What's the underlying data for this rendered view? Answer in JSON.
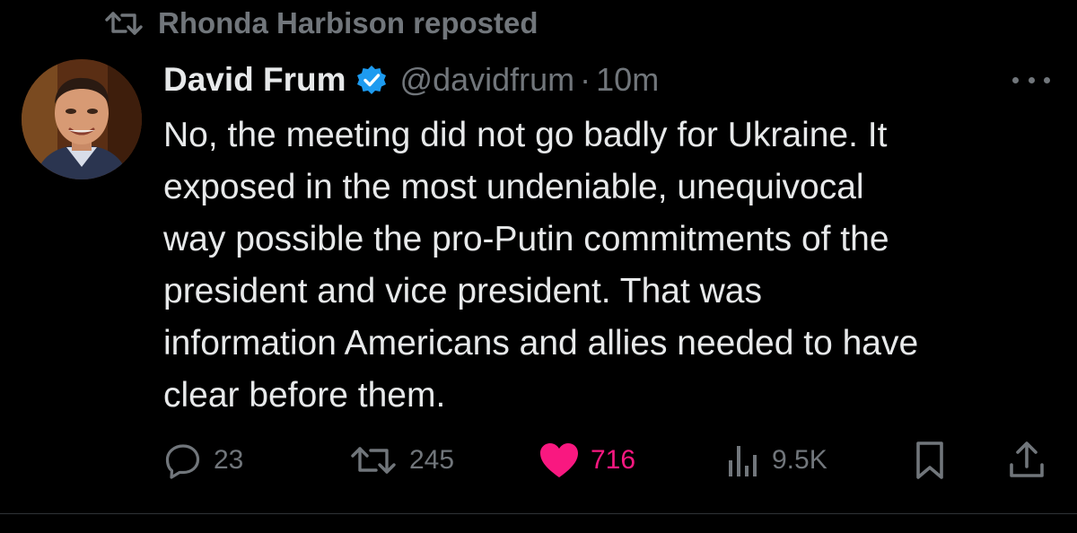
{
  "repost": {
    "label": "Rhonda Harbison reposted",
    "icon": "repost-icon"
  },
  "author": {
    "name": "David Frum",
    "verified": true,
    "verified_color": "#1d9bf0",
    "handle": "@davidfrum",
    "separator": "·",
    "time": "10m",
    "avatar_icon": "avatar"
  },
  "tweet": {
    "lines": [
      "No, the meeting did not go badly for Ukraine. It",
      "exposed in the most undeniable, unequivocal",
      "way possible the pro-Putin commitments of the",
      "president and vice president. That was",
      "information Americans and allies needed to have",
      "clear before them."
    ]
  },
  "actions": {
    "replies": "23",
    "reposts": "245",
    "likes": "716",
    "views": "9.5K",
    "like_color": "#f91880",
    "muted_color": "#71767b"
  }
}
